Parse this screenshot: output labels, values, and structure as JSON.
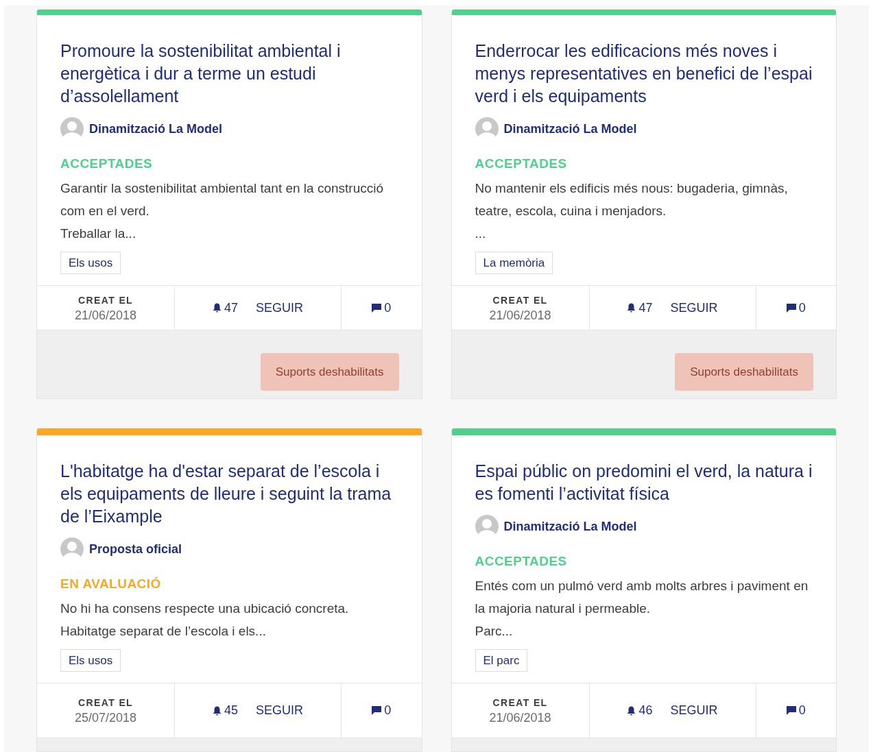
{
  "cards": [
    {
      "title": "Promoure la sostenibilitat ambiental i energètica i dur a terme un estudi d’assolellament",
      "author": "Dinamització La Model",
      "status": {
        "kind": "accepted",
        "label": "ACCEPTADES"
      },
      "description": [
        "Garantir la sostenibilitat ambiental tant en la construcció com en el verd.",
        "Treballar la..."
      ],
      "tag": "Els usos",
      "created_label": "CREAT EL",
      "created_date": "21/06/2018",
      "followers": "47",
      "follow_label": "SEGUIR",
      "comments": "0",
      "supports": {
        "label": "Suports deshabilitats",
        "disabled": true
      }
    },
    {
      "title": "Enderrocar les edificacions més noves i menys representatives en benefici de l’espai verd i els equipaments",
      "author": "Dinamització La Model",
      "status": {
        "kind": "accepted",
        "label": "ACCEPTADES"
      },
      "description": [
        "No mantenir els edificis més nous: bugaderia, gimnàs, teatre, escola, cuina i menjadors.",
        "..."
      ],
      "tag": "La memòria",
      "created_label": "CREAT EL",
      "created_date": "21/06/2018",
      "followers": "47",
      "follow_label": "SEGUIR",
      "comments": "0",
      "supports": {
        "label": "Suports deshabilitats",
        "disabled": true
      }
    },
    {
      "title": "L'habitatge ha d'estar separat de l’escola i els equipaments de lleure i seguint la trama de l’Eixample",
      "author": "Proposta oficial",
      "status": {
        "kind": "evaluating",
        "label": "EN AVALUACIÓ"
      },
      "description": [
        "No hi ha consens respecte una ubicació concreta.",
        "Habitatge separat de l’escola i els..."
      ],
      "tag": "Els usos",
      "created_label": "CREAT EL",
      "created_date": "25/07/2018",
      "followers": "45",
      "follow_label": "SEGUIR",
      "comments": "0"
    },
    {
      "title": "Espai públic on predomini el verd, la natura i es fomenti l’activitat física",
      "author": "Dinamització La Model",
      "status": {
        "kind": "accepted",
        "label": "ACCEPTADES"
      },
      "description": [
        "Entés com un pulmó verd amb molts arbres i paviment en la majoria natural i permeable.",
        "Parc..."
      ],
      "tag": "El parc",
      "created_label": "CREAT EL",
      "created_date": "21/06/2018",
      "followers": "46",
      "follow_label": "SEGUIR",
      "comments": "0"
    }
  ]
}
